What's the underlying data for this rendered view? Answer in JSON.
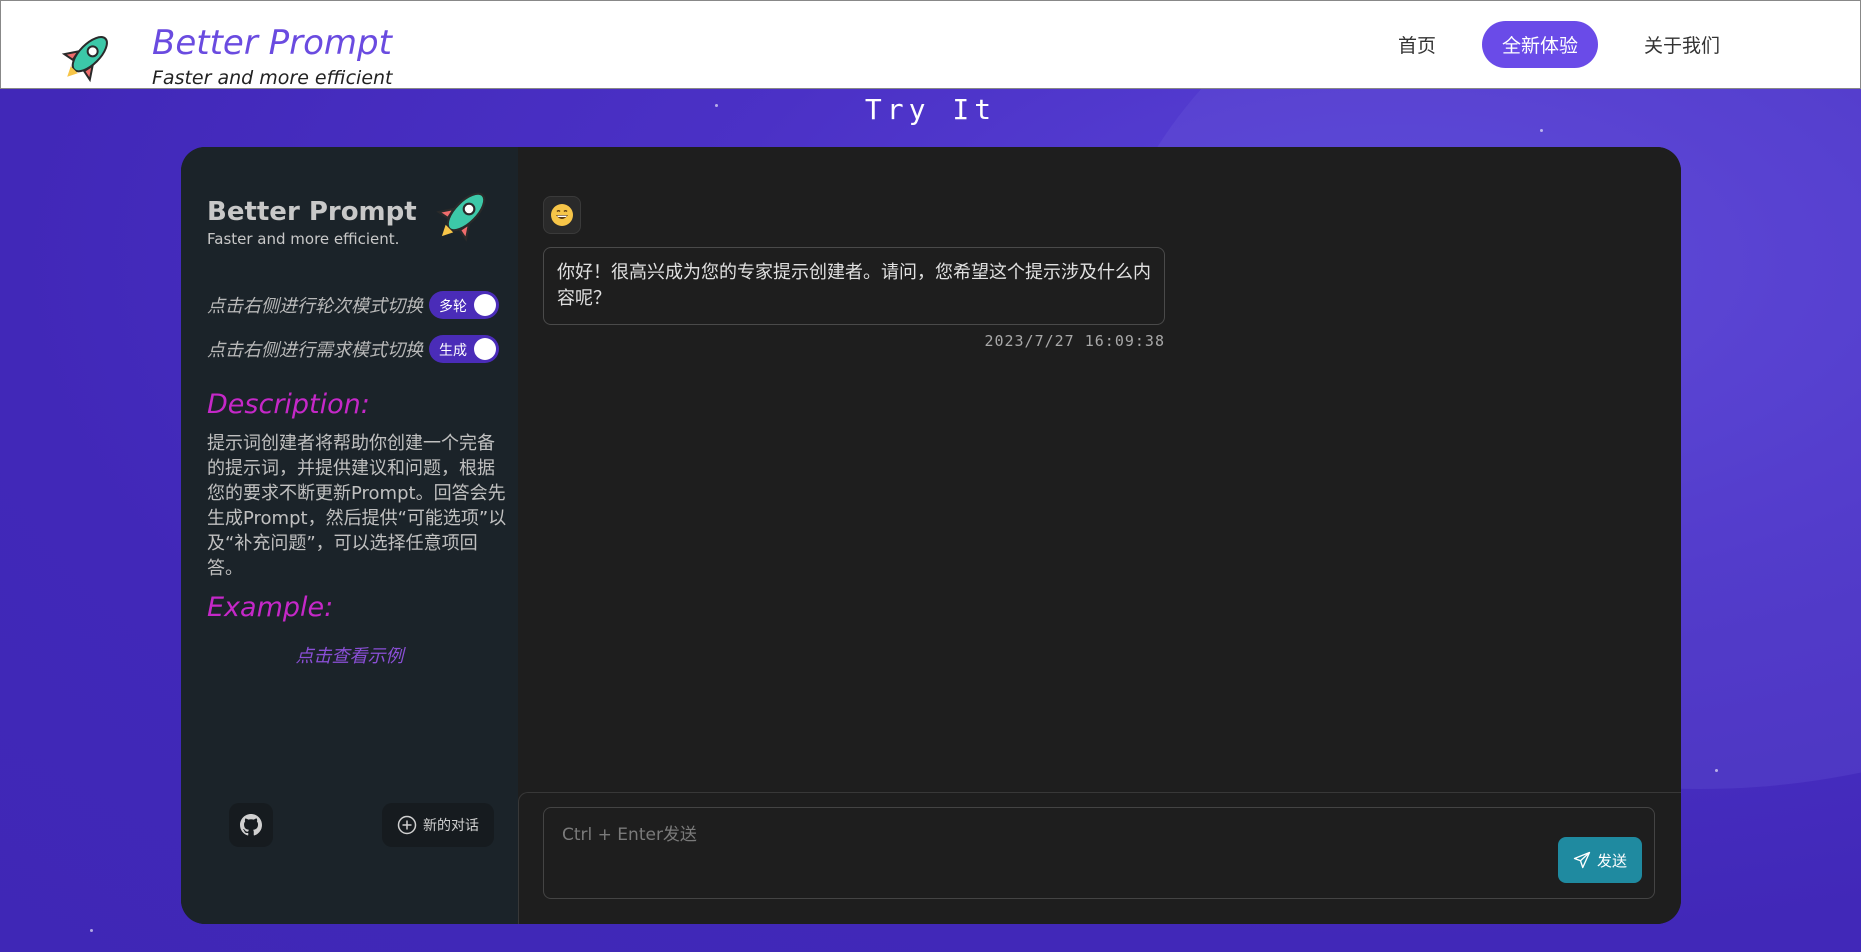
{
  "header": {
    "brand_title": "Better Prompt",
    "brand_subtitle": "Faster and more efficient",
    "logo_icon": "rocket-icon",
    "nav": [
      {
        "label": "首页",
        "active": false
      },
      {
        "label": "全新体验",
        "active": true
      },
      {
        "label": "关于我们",
        "active": false
      }
    ]
  },
  "hero": {
    "title": "Try It"
  },
  "sidebar": {
    "title": "Better Prompt",
    "subtitle": "Faster and more efficient.",
    "round_mode": {
      "label": "点击右侧进行轮次模式切换",
      "value": "多轮"
    },
    "demand_mode": {
      "label": "点击右侧进行需求模式切换",
      "value": "生成"
    },
    "description_heading": "Description:",
    "description_text": "提示词创建者将帮助你创建一个完备的提示词，并提供建议和问题，根据您的要求不断更新Prompt。回答会先生成Prompt，然后提供“可能选项”以及“补充问题”，可以选择任意项回答。",
    "example_heading": "Example:",
    "example_link": "点击查看示例",
    "new_chat_label": "新的对话"
  },
  "chat": {
    "messages": [
      {
        "avatar": "grinning-face-icon",
        "text": "你好！很高兴成为您的专家提示创建者。请问，您希望这个提示涉及什么内容呢？",
        "timestamp": "2023/7/27 16:09:38"
      }
    ],
    "input_placeholder": "Ctrl + Enter发送",
    "send_label": "发送"
  },
  "colors": {
    "brand_purple": "#6a4be0",
    "nav_active": "#6a4be8",
    "background": "#4a2fc4",
    "sidebar_bg": "#1b2329",
    "chat_bg": "#1e1e1e",
    "heading_magenta": "#c528c8",
    "toggle": "#4a2cb8",
    "send_button": "#1f8aa0"
  }
}
